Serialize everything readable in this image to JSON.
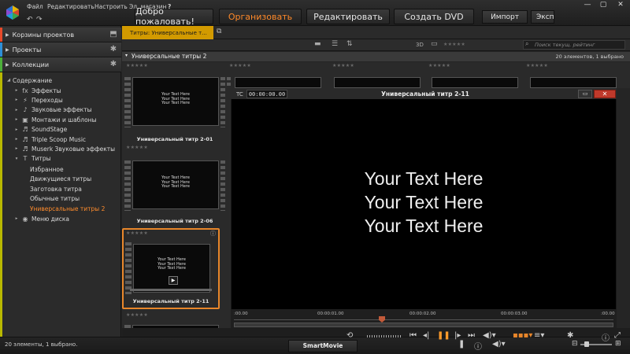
{
  "menu": [
    "Файл",
    "Редактировать",
    "Настроить",
    "Эл. магазин"
  ],
  "help_icon": "?",
  "undo": "↶",
  "redo": "↷",
  "main_tabs": [
    "Добро пожаловать!",
    "Организовать",
    "Редактировать",
    "Создать DVD"
  ],
  "active_tab": "Организовать",
  "import_label": "Импорт",
  "export_label": "Экспо",
  "window_controls": [
    "—",
    "▢",
    "✕"
  ],
  "left": {
    "sections": [
      "Корзины проектов",
      "Проекты",
      "Коллекции"
    ],
    "content_title": "Содержание",
    "tree": [
      {
        "label": "Эффекты",
        "icon": "fx",
        "tri": "▸"
      },
      {
        "label": "Переходы",
        "icon": "⚡",
        "tri": "▸"
      },
      {
        "label": "Звуковые эффекты",
        "icon": "♪",
        "tri": "▸"
      },
      {
        "label": "Монтажи и шаблоны",
        "icon": "▣",
        "tri": "▸"
      },
      {
        "label": "SoundStage",
        "icon": "♬",
        "tri": "▸"
      },
      {
        "label": "Triple Scoop Music",
        "icon": "♬",
        "tri": "▸"
      },
      {
        "label": "Muserk Звуковые эффекты",
        "icon": "♬",
        "tri": "▸"
      },
      {
        "label": "Титры",
        "icon": "T",
        "tri": "▾"
      }
    ],
    "titles_children": [
      "Избранное",
      "Движущиеся титры",
      "Заготовка титра",
      "Обычные титры",
      "Универсальные титры 2"
    ],
    "disc_menu": "Меню диска"
  },
  "library": {
    "tab_label": "Титры: Универсальные т...",
    "breadcrumb": "Универсальные титры 2",
    "count": "20 элементов, 1 выбрано",
    "search_placeholder": "Поиск текущ. рейтинг",
    "view_3d": "3D",
    "stars": "★★★★★",
    "thumb_text": "Your Text Here",
    "items": [
      {
        "caption": "Универсальный титр 2-01"
      },
      {
        "caption": "Универсальный титр 2-06"
      },
      {
        "caption": "Универсальный титр 2-11"
      }
    ]
  },
  "player": {
    "tc_label": "TC",
    "timecode": "00:00:00.00",
    "title": "Универсальный титр 2-11",
    "lines": [
      "Your Text Here",
      "Your Text Here",
      "Your Text Here"
    ],
    "ticks": [
      ":00.00",
      "00:00:01.00",
      "00:00:02.00",
      "00:00:03.00",
      ":00.00"
    ]
  },
  "status": {
    "text": "20 элементы, 1 выбрано.",
    "smartmovie": "SmartMovie"
  },
  "colors": {
    "accent": "#ff8a2a",
    "tab_yellow": "#d29a00",
    "red_close": "#c0392b"
  }
}
